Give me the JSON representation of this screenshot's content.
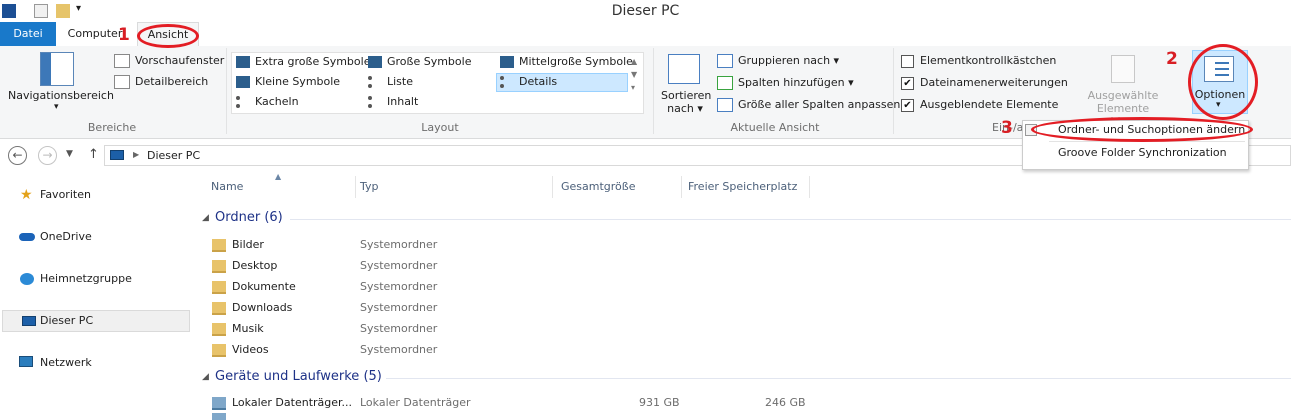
{
  "window": {
    "title": "Dieser PC"
  },
  "tabs": [
    {
      "label": "Datei"
    },
    {
      "label": "Computer"
    },
    {
      "label": "Ansicht"
    }
  ],
  "ribbon": {
    "bereiche": {
      "label": "Bereiche",
      "nav_pane": "Navigationsbereich",
      "preview": "Vorschaufenster",
      "details": "Detailbereich"
    },
    "layout": {
      "label": "Layout",
      "items": [
        "Extra große Symbole",
        "Große Symbole",
        "Mittelgroße Symbole",
        "Kleine Symbole",
        "Liste",
        "Details",
        "Kacheln",
        "Inhalt"
      ],
      "selected": "Details"
    },
    "aktuelle_ansicht": {
      "label": "Aktuelle Ansicht",
      "sort": "Sortieren",
      "sort2": "nach",
      "group_by": "Gruppieren nach",
      "add_cols": "Spalten hinzufügen",
      "fit_cols": "Größe aller Spalten anpassen"
    },
    "einblenden": {
      "label": "Ein-/ausblenden",
      "checkboxes": [
        {
          "label": "Elementkontrollkästchen",
          "checked": false
        },
        {
          "label": "Dateinamenerweiterungen",
          "checked": true
        },
        {
          "label": "Ausgeblendete Elemente",
          "checked": true
        }
      ],
      "hide_sel_1": "Ausgewählte",
      "hide_sel_2": "Elemente ausblenden",
      "options": "Optionen"
    }
  },
  "annotations": [
    "1",
    "2",
    "3"
  ],
  "options_menu": {
    "items": [
      "Ordner- und Suchoptionen ändern",
      "Groove Folder Synchronization"
    ]
  },
  "address": {
    "path": "Dieser PC"
  },
  "nav": {
    "items": [
      "Favoriten",
      "OneDrive",
      "Heimnetzgruppe",
      "Dieser PC",
      "Netzwerk"
    ],
    "selected": "Dieser PC"
  },
  "columns": [
    "Name",
    "Typ",
    "Gesamtgröße",
    "Freier Speicherplatz"
  ],
  "groups": {
    "folders": "Ordner (6)",
    "drives": "Geräte und Laufwerke (5)"
  },
  "folders": [
    {
      "name": "Bilder",
      "type": "Systemordner"
    },
    {
      "name": "Desktop",
      "type": "Systemordner"
    },
    {
      "name": "Dokumente",
      "type": "Systemordner"
    },
    {
      "name": "Downloads",
      "type": "Systemordner"
    },
    {
      "name": "Musik",
      "type": "Systemordner"
    },
    {
      "name": "Videos",
      "type": "Systemordner"
    }
  ],
  "drives": [
    {
      "name": "Lokaler Datenträger...",
      "type": "Lokaler Datenträger",
      "size": "931 GB",
      "free": "246 GB"
    }
  ],
  "colors": {
    "accent": "#1979ca",
    "annotation": "#e31d24",
    "group": "#1e3287"
  }
}
